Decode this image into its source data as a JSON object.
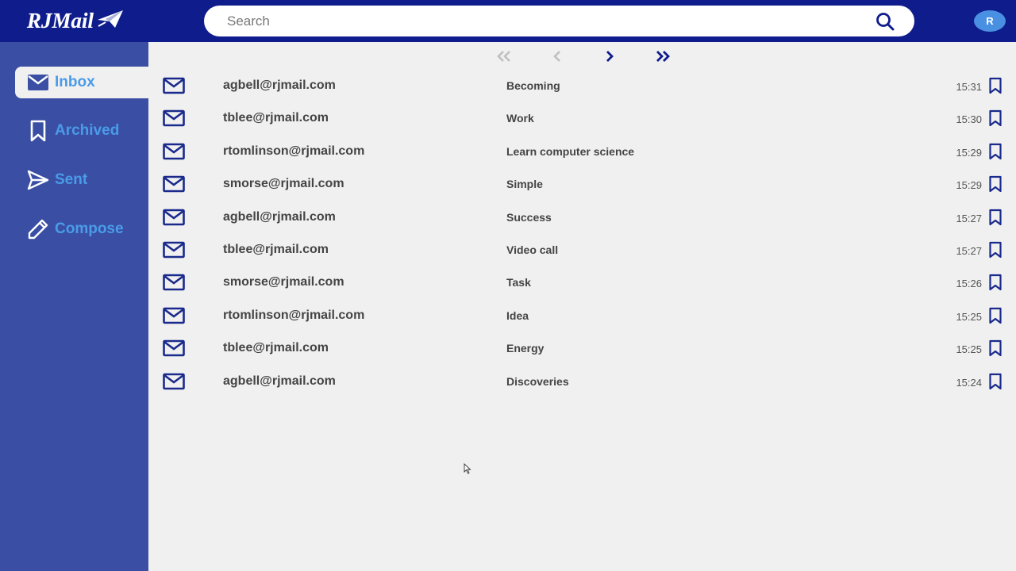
{
  "app": {
    "logo_text": "RJMail",
    "avatar_initial": "R"
  },
  "search": {
    "placeholder": "Search",
    "value": ""
  },
  "sidebar": {
    "items": [
      {
        "label": "Inbox",
        "icon": "envelope-icon",
        "active": true
      },
      {
        "label": "Archived",
        "icon": "bookmark-icon",
        "active": false
      },
      {
        "label": "Sent",
        "icon": "send-icon",
        "active": false
      },
      {
        "label": "Compose",
        "icon": "pencil-icon",
        "active": false
      }
    ]
  },
  "pagination": {
    "first": "first-page-icon",
    "prev": "prev-page-icon",
    "next": "next-page-icon",
    "last": "last-page-icon"
  },
  "emails": [
    {
      "sender": "agbell@rjmail.com",
      "subject": "Becoming",
      "time": "15:31"
    },
    {
      "sender": "tblee@rjmail.com",
      "subject": "Work",
      "time": "15:30"
    },
    {
      "sender": "rtomlinson@rjmail.com",
      "subject": "Learn computer science",
      "time": "15:29"
    },
    {
      "sender": "smorse@rjmail.com",
      "subject": "Simple",
      "time": "15:29"
    },
    {
      "sender": "agbell@rjmail.com",
      "subject": "Success",
      "time": "15:27"
    },
    {
      "sender": "tblee@rjmail.com",
      "subject": "Video call",
      "time": "15:27"
    },
    {
      "sender": "smorse@rjmail.com",
      "subject": "Task",
      "time": "15:26"
    },
    {
      "sender": "rtomlinson@rjmail.com",
      "subject": "Idea",
      "time": "15:25"
    },
    {
      "sender": "tblee@rjmail.com",
      "subject": "Energy",
      "time": "15:25"
    },
    {
      "sender": "agbell@rjmail.com",
      "subject": "Discoveries",
      "time": "15:24"
    }
  ],
  "colors": {
    "header": "#0e1c8c",
    "sidebar": "#3a4fa3",
    "accent": "#4a9be8",
    "icon": "#1a2a8c",
    "background": "#f0f0f0"
  }
}
